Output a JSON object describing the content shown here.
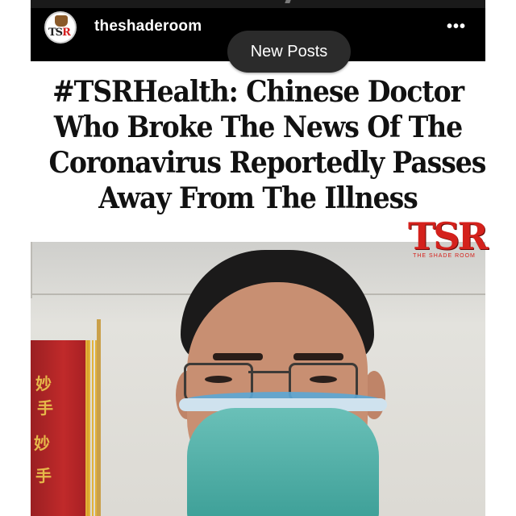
{
  "post": {
    "username": "theshaderoom",
    "more_icon": "more-dots-icon",
    "avatar_text_primary": "TS",
    "avatar_text_accent": "R"
  },
  "toast": {
    "label": "New Posts"
  },
  "headline": {
    "lines": [
      "#TSRHealth: Chinese Doctor",
      "Who Broke The News Of The",
      "Coronavirus Reportedly Passes",
      "Away From The Illness"
    ]
  },
  "watermark": {
    "logo_text": "TSR",
    "tagline": "THE SHADE ROOM"
  },
  "colors": {
    "header_bg": "#000000",
    "brand_red": "#d4211c",
    "toast_bg": "#2b2b2b"
  }
}
